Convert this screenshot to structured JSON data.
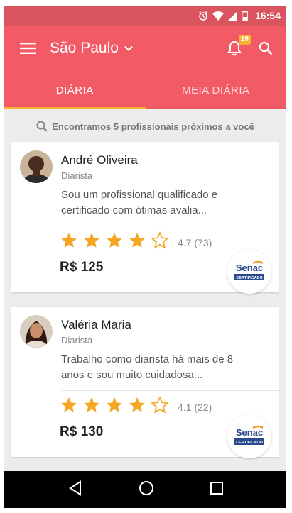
{
  "status_bar": {
    "time": "16:54",
    "icons": [
      "alarm-icon",
      "wifi-icon",
      "signal-icon",
      "battery-icon"
    ]
  },
  "app_bar": {
    "city": "São Paulo",
    "notification_count": "19",
    "icons": [
      "menu-icon",
      "chevron-down-icon",
      "bell-icon",
      "search-icon"
    ]
  },
  "tabs": [
    {
      "label": "DIÁRIA",
      "active": true
    },
    {
      "label": "MEIA DIÁRIA",
      "active": false
    }
  ],
  "search_hint": "Encontramos 5 profissionais próximos a você",
  "professionals": [
    {
      "name": "André Oliveira",
      "role": "Diarista",
      "description": "Sou um profissional qualificado e certificado com ótimas avalia...",
      "stars": 4,
      "rating": "4.7 (73)",
      "price": "R$ 125",
      "certification": {
        "brand": "Senac",
        "label": "CERTIFICADO"
      }
    },
    {
      "name": "Valéria Maria",
      "role": "Diarista",
      "description": "Trabalho como diarista há mais de 8 anos e sou muito cuidadosa...",
      "stars": 4,
      "rating": "4.1 (22)",
      "price": "R$ 130",
      "certification": {
        "brand": "Senac",
        "label": "CERTIFICADO"
      }
    }
  ],
  "colors": {
    "primary": "#f25a66",
    "status_bar": "#d9545e",
    "accent": "#f7b233",
    "star": "#f5a623"
  },
  "nav_bar": {
    "icons": [
      "back-icon",
      "home-icon",
      "recents-icon"
    ]
  }
}
